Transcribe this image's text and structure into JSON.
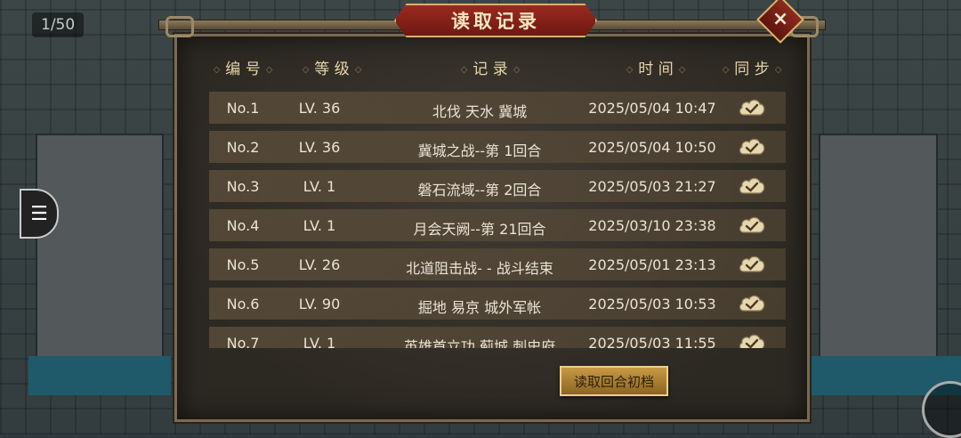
{
  "page_counter": "1/50",
  "dialog": {
    "title": "读取记录",
    "close_icon": "×",
    "columns": {
      "number": "编 号",
      "level": "等 级",
      "record": "记 录",
      "time": "时 间",
      "sync": "同 步"
    },
    "rows": [
      {
        "number": "No.1",
        "level": "LV. 36",
        "record": "北伐 天水 冀城",
        "time": "2025/05/04 10:47",
        "sync_icon": "cloud-check-icon"
      },
      {
        "number": "No.2",
        "level": "LV. 36",
        "record": "冀城之战--第 1回合",
        "time": "2025/05/04 10:50",
        "sync_icon": "cloud-check-icon"
      },
      {
        "number": "No.3",
        "level": "LV. 1",
        "record": "磐石流域--第 2回合",
        "time": "2025/05/03 21:27",
        "sync_icon": "cloud-check-icon"
      },
      {
        "number": "No.4",
        "level": "LV. 1",
        "record": "月会天阙--第 21回合",
        "time": "2025/03/10 23:38",
        "sync_icon": "cloud-check-icon"
      },
      {
        "number": "No.5",
        "level": "LV. 26",
        "record": "北道阻击战- - 战斗结束",
        "time": "2025/05/01 23:13",
        "sync_icon": "cloud-check-icon"
      },
      {
        "number": "No.6",
        "level": "LV. 90",
        "record": "掘地 易京  城外军帐",
        "time": "2025/05/03 10:53",
        "sync_icon": "cloud-check-icon"
      },
      {
        "number": "No.7",
        "level": "LV. 1",
        "record": "英雄首立功 蓟城  刺史府",
        "time": "2025/05/03 11:55",
        "sync_icon": "cloud-check-icon"
      }
    ],
    "load_button": "读取回合初档"
  },
  "colors": {
    "title_plate": "#8a2218",
    "text_gold": "#e7d4a7",
    "button_gold": "#c79a44"
  }
}
